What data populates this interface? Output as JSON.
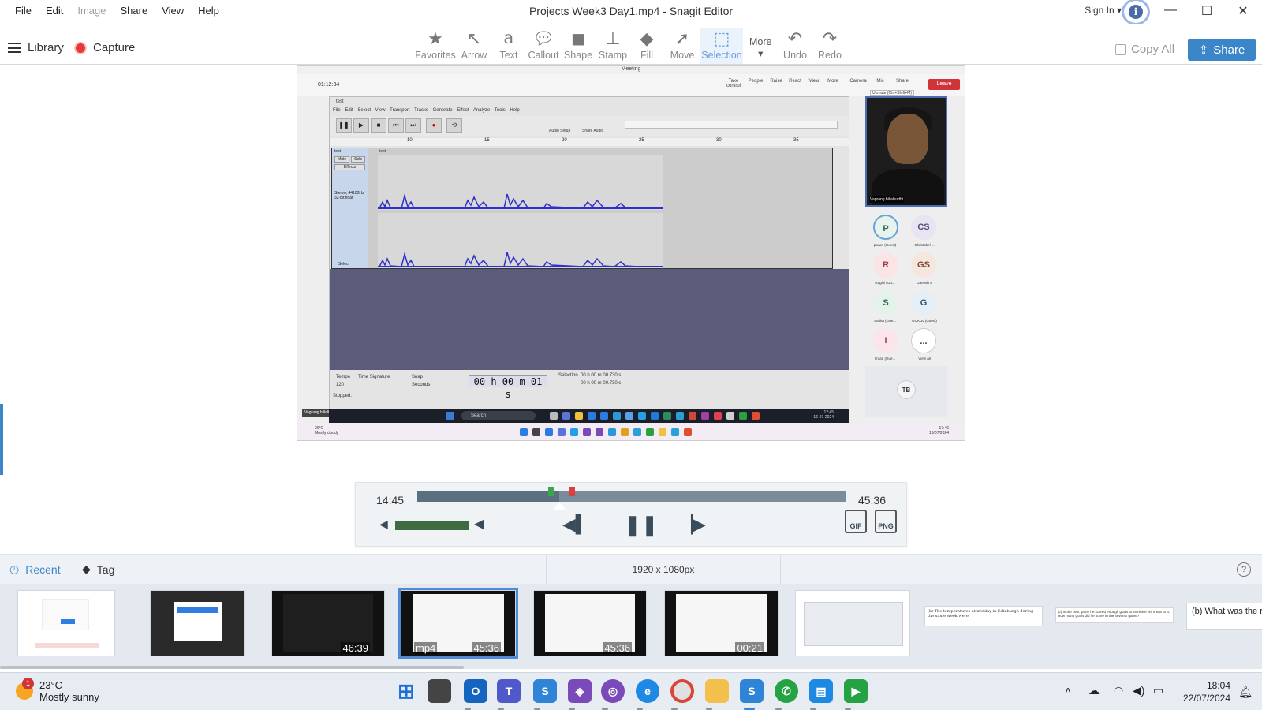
{
  "app": {
    "window_title": "Projects Week3 Day1.mp4 - Snagit Editor",
    "menu": [
      "File",
      "Edit",
      "Image",
      "Share",
      "View",
      "Help"
    ],
    "sign_in": "Sign In",
    "window_controls": [
      "minimize-icon",
      "maximize-icon",
      "close-icon"
    ]
  },
  "toolbar": {
    "library_label": "Library",
    "capture_label": "Capture",
    "tools": [
      {
        "label": "Favorites",
        "icon": "star-icon"
      },
      {
        "label": "Arrow",
        "icon": "arrow-icon"
      },
      {
        "label": "Text",
        "icon": "text-icon"
      },
      {
        "label": "Callout",
        "icon": "callout-icon"
      },
      {
        "label": "Shape",
        "icon": "shape-icon"
      },
      {
        "label": "Stamp",
        "icon": "stamp-icon"
      },
      {
        "label": "Fill",
        "icon": "fill-icon"
      },
      {
        "label": "Move",
        "icon": "move-icon"
      },
      {
        "label": "Selection",
        "icon": "selection-icon"
      }
    ],
    "more_label": "More",
    "undo_label": "Undo",
    "redo_label": "Redo",
    "copy_all_label": "Copy All",
    "share_label": "Share",
    "accent_color": "#3a86c8"
  },
  "frame": {
    "meeting_title": "Meeting",
    "meeting_timer": "01:12:34",
    "meeting_tools": [
      "Take control",
      "People",
      "Raise",
      "React",
      "View",
      "More",
      "Camera",
      "Mic",
      "Share"
    ],
    "leave_label": "Leave",
    "unmute_tip": "Unmute (Ctrl+Shift+M)",
    "audacity": {
      "title": "test",
      "menu": "File  Edit  Select  View  Transport  Tracks  Generate  Effect  Analyze  Tools  Help",
      "ruler": [
        "10",
        "15",
        "20",
        "25",
        "30",
        "35"
      ],
      "track_name": "test",
      "track_info": "Stereo, 44100Hz 32-bit float",
      "mute": "Mute",
      "solo": "Solo",
      "effects": "Effects",
      "select": "Select",
      "time_display": "00 h 00 m 01 s",
      "tempo_label": "Tempo",
      "tempo_value": "120",
      "time_signature_label": "Time Signature",
      "snap_label": "Snap",
      "snap_unit": "Seconds",
      "selection_label": "Selection",
      "selection_start": "00 h 00 m 00.730 s",
      "selection_end": "00 h 00 m 00.730 s",
      "status": "Stopped.",
      "audio_setup": "Audio Setup",
      "share_audio": "Share Audio"
    },
    "video_tile_name": "Vagrang billalkurthi",
    "participants": [
      {
        "initials": "P",
        "name": "pavan (Guest)"
      },
      {
        "initials": "CS",
        "name": "Christabel ..."
      },
      {
        "initials": "R",
        "name": "Ragini (Gu..."
      },
      {
        "initials": "GS",
        "name": "Ganesh S"
      },
      {
        "initials": "S",
        "name": "Sarika (Gue..."
      },
      {
        "initials": "G",
        "name": "GOKUL (Guest)"
      },
      {
        "initials": "I",
        "name": "Imran (Gue..."
      },
      {
        "initials": "...",
        "name": "View all"
      }
    ],
    "tb_initials": "TB",
    "inner_search": "Search",
    "inner_clock": {
      "time": "12:45",
      "date": "16-07-2024"
    },
    "outer_weather": {
      "temp": "20°C",
      "desc": "Mostly cloudy"
    },
    "outer_clock": {
      "time": "17:46",
      "date": "16/07/2024"
    }
  },
  "player": {
    "current_time": "14:45",
    "total_time": "45:36",
    "progress": 0.33,
    "volume": 0.85,
    "gif_label": "GIF",
    "png_label": "PNG"
  },
  "tray": {
    "recent_label": "Recent",
    "tag_label": "Tag",
    "resolution": "1920 x 1080px",
    "help": "?",
    "thumbnails": [
      {
        "kind": "image",
        "duration": ""
      },
      {
        "kind": "image",
        "duration": ""
      },
      {
        "kind": "video",
        "duration": "46:39"
      },
      {
        "kind": "video",
        "type": "mp4",
        "duration": "45:36",
        "selected": true
      },
      {
        "kind": "video",
        "duration": "45:36"
      },
      {
        "kind": "video",
        "duration": "00:21"
      },
      {
        "kind": "image",
        "duration": ""
      },
      {
        "kind": "image",
        "duration": "",
        "text": "(b) The temperatures at midday in Edinburgh during the same week were"
      },
      {
        "kind": "image",
        "duration": "",
        "text": "(c) In the next game he scored enough goals to increase his mean to 4. How many goals did he score in the seventh game?"
      },
      {
        "kind": "image",
        "duration": "",
        "text": "(b) What was the r"
      }
    ]
  },
  "taskbar": {
    "weather_temp": "23°C",
    "weather_desc": "Mostly sunny",
    "weather_badge": "1",
    "time": "18:04",
    "date": "22/07/2024"
  }
}
